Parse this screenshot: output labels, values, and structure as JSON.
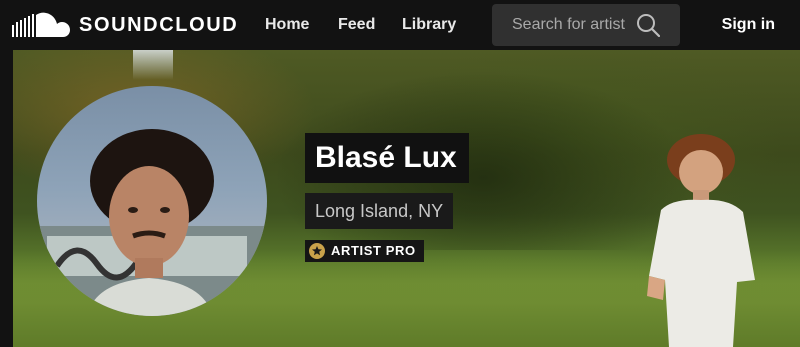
{
  "header": {
    "brand": "SOUNDCLOUD",
    "nav": [
      "Home",
      "Feed",
      "Library"
    ],
    "search": {
      "placeholder": "Search for artist",
      "value": ""
    },
    "sign_in": "Sign in",
    "icons": {
      "logo": "soundcloud-cloud-icon",
      "search": "search-icon"
    }
  },
  "profile": {
    "name": "Blasé Lux",
    "location": "Long Island, NY",
    "badge": "ARTIST PRO",
    "badge_icon": "star-icon"
  },
  "colors": {
    "header_bg": "#121212",
    "search_bg": "#303030",
    "badge_star": "#c9a24a"
  }
}
